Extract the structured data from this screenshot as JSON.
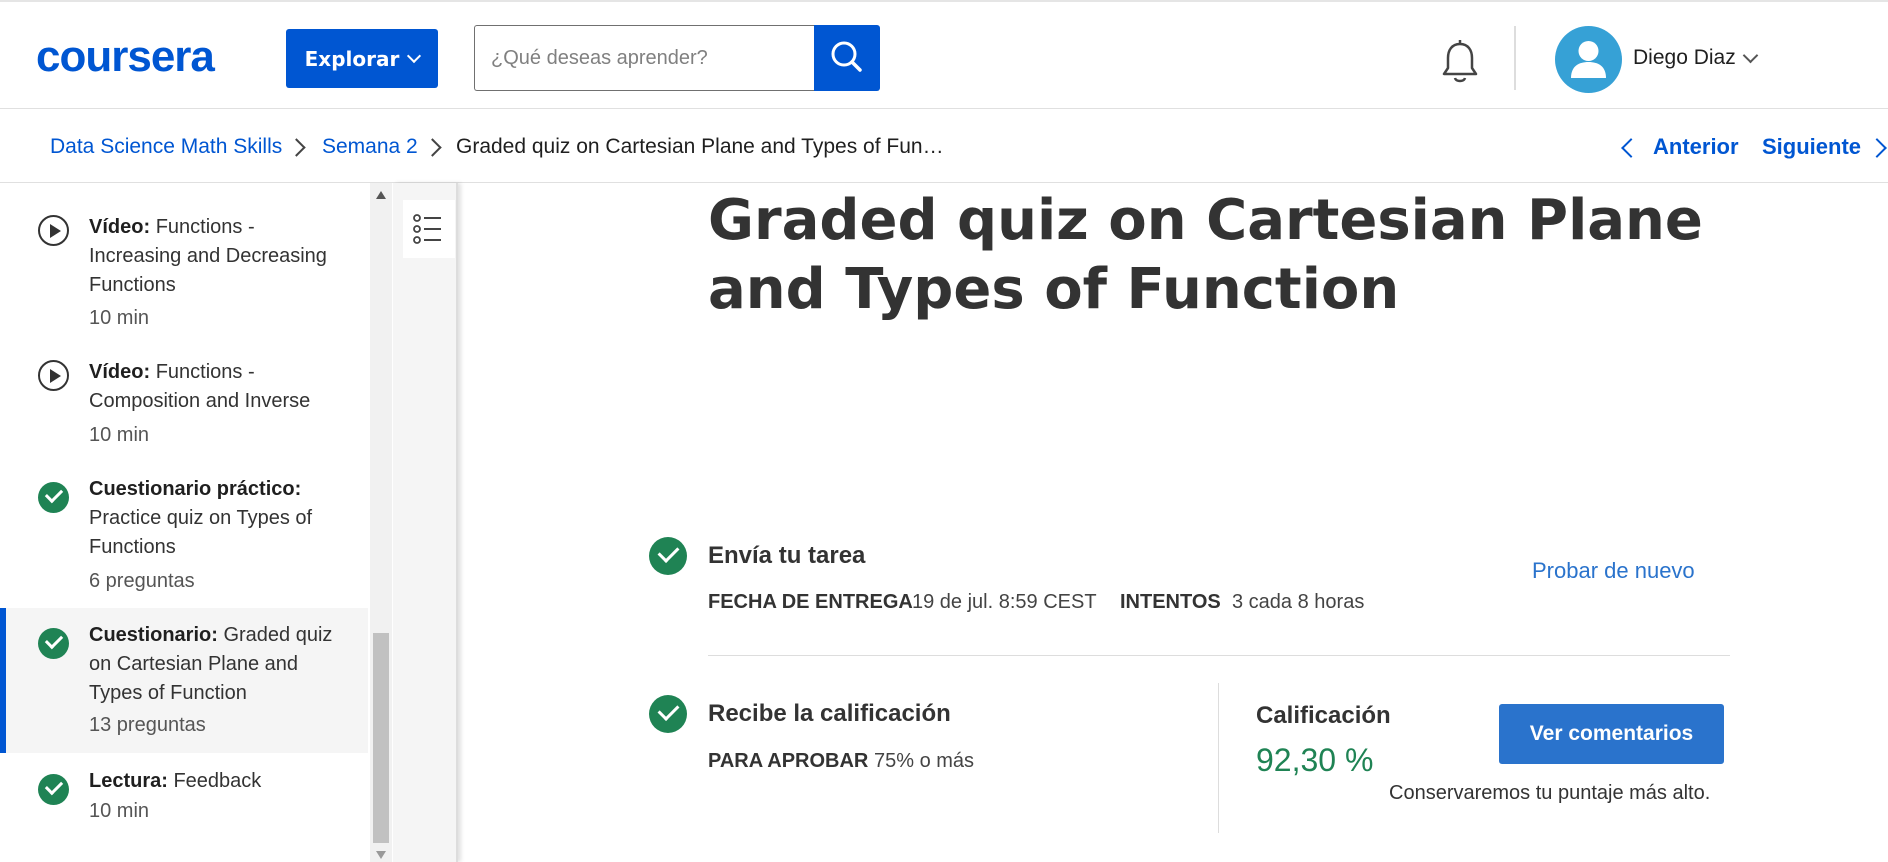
{
  "header": {
    "logo": "coursera",
    "explore_label": "Explorar",
    "search_placeholder": "¿Qué deseas aprender?",
    "user_name": "Diego Diaz"
  },
  "breadcrumb": {
    "course": "Data Science Math Skills",
    "week": "Semana 2",
    "current": "Graded quiz on Cartesian Plane and Types of Fun…",
    "prev_label": "Anterior",
    "next_label": "Siguiente"
  },
  "sidebar": {
    "items": [
      {
        "type_label": "Vídeo:",
        "title": "Functions - Increasing and Decreasing Functions",
        "meta": "10 min",
        "status": "play"
      },
      {
        "type_label": "Vídeo:",
        "title": "Functions - Composition and Inverse",
        "meta": "10 min",
        "status": "play"
      },
      {
        "type_label": "Cuestionario práctico:",
        "title": "Practice quiz on Types of Functions",
        "meta": "6 preguntas",
        "status": "done"
      },
      {
        "type_label": "Cuestionario:",
        "title": "Graded quiz on Cartesian Plane and Types of Function",
        "meta": "13 preguntas",
        "status": "done",
        "active": true
      },
      {
        "type_label": "Lectura:",
        "title": "Feedback",
        "meta": "10 min",
        "status": "done"
      }
    ]
  },
  "main": {
    "title": "Graded quiz on Cartesian Plane and Types of Function",
    "submit": {
      "title": "Envía tu tarea",
      "due_label": "FECHA DE ENTREGA",
      "due_value": "19 de jul. 8:59 CEST",
      "attempts_label": "INTENTOS",
      "attempts_value": "3 cada 8 horas",
      "retry_label": "Probar de nuevo"
    },
    "grade": {
      "title": "Recibe la calificación",
      "pass_label": "PARA APROBAR",
      "pass_value": "75% o más",
      "grade_label": "Calificación",
      "grade_value": "92,30 %",
      "feedback_button": "Ver comentarios",
      "note": "Conservaremos tu puntaje más alto."
    }
  },
  "colors": {
    "brand_blue": "#0056d2",
    "success_green": "#1f8354",
    "link_blue": "#2a73cc"
  }
}
